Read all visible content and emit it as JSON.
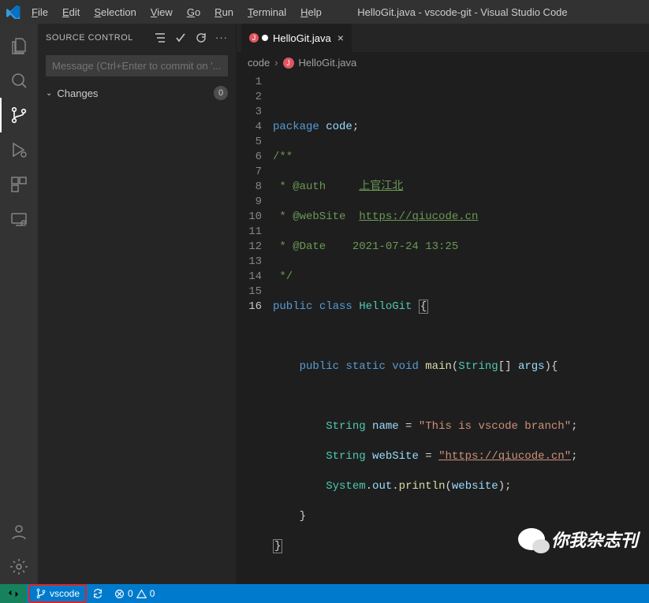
{
  "menubar": [
    "File",
    "Edit",
    "Selection",
    "View",
    "Go",
    "Run",
    "Terminal",
    "Help"
  ],
  "window_title": "HelloGit.java - vscode-git - Visual Studio Code",
  "sidebar": {
    "title": "SOURCE CONTROL",
    "commit_placeholder": "Message (Ctrl+Enter to commit on '...",
    "changes_label": "Changes",
    "changes_count": "0"
  },
  "tab": {
    "filename": "HelloGit.java",
    "modified": true
  },
  "breadcrumb": {
    "folder": "code",
    "file": "HelloGit.java"
  },
  "code": {
    "line_numbers": [
      "1",
      "2",
      "3",
      "4",
      "5",
      "6",
      "7",
      "8",
      "9",
      "10",
      "11",
      "12",
      "13",
      "14",
      "15",
      "16"
    ],
    "current_line": 16,
    "lines": {
      "l2_pkg": "package",
      "l2_name": "code",
      "l3": "/**",
      "l4a": " * @auth",
      "l4b": "上官江北",
      "l5a": " * @webSite",
      "l5b": "https://qiucode.cn",
      "l6": " * @Date    2021-07-24 13:25",
      "l7": " */",
      "l8_pub": "public",
      "l8_cls": "class",
      "l8_name": "HelloGit",
      "l10_pub": "public",
      "l10_stat": "static",
      "l10_void": "void",
      "l10_main": "main",
      "l10_str": "String",
      "l10_args": "args",
      "l12_str": "String",
      "l12_var": "name",
      "l12_val": "\"This is vscode branch\"",
      "l13_str": "String",
      "l13_var": "webSite",
      "l13_val": "\"https://qiucode.cn\"",
      "l14_sys": "System",
      "l14_out": "out",
      "l14_pl": "println",
      "l14_arg": "website"
    }
  },
  "statusbar": {
    "branch": "vscode",
    "errors": "0",
    "warnings": "0"
  },
  "wechat_label": "你我杂志刊"
}
